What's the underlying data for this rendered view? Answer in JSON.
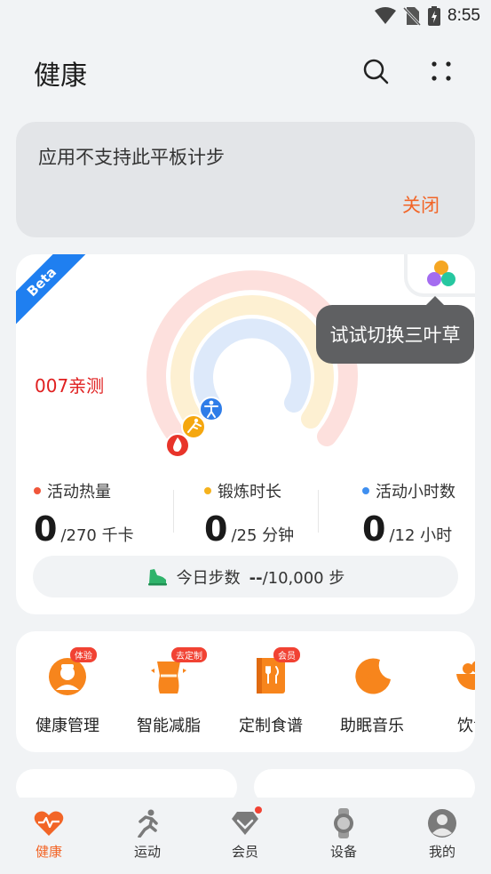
{
  "status_bar": {
    "time": "8:55"
  },
  "header": {
    "title": "健康"
  },
  "notice": {
    "text": "应用不支持此平板计步",
    "close_label": "关闭"
  },
  "activity_card": {
    "badge": "Beta",
    "rings_label": "007亲测",
    "tooltip": "试试切换三叶草",
    "metrics": [
      {
        "label": "活动热量",
        "value": "0",
        "goal": "/270 千卡",
        "color": "#f0563a"
      },
      {
        "label": "锻炼时长",
        "value": "0",
        "goal": "/25 分钟",
        "color": "#f5b21d"
      },
      {
        "label": "活动小时数",
        "value": "0",
        "goal": "/12 小时",
        "color": "#3f8ff0"
      }
    ],
    "steps": {
      "label": "今日步数",
      "value": "--",
      "goal": "/10,000 步"
    }
  },
  "services": [
    {
      "label": "健康管理",
      "badge": "体验"
    },
    {
      "label": "智能减脂",
      "badge": "去定制"
    },
    {
      "label": "定制食谱",
      "badge": "会员"
    },
    {
      "label": "助眠音乐",
      "badge": ""
    },
    {
      "label": "饮食",
      "badge": ""
    }
  ],
  "tabs": [
    {
      "label": "健康",
      "icon": "heart-pulse-icon",
      "active": true
    },
    {
      "label": "运动",
      "icon": "runner-icon",
      "active": false
    },
    {
      "label": "会员",
      "icon": "diamond-icon",
      "active": false
    },
    {
      "label": "设备",
      "icon": "watch-icon",
      "active": false
    },
    {
      "label": "我的",
      "icon": "profile-icon",
      "active": false
    }
  ],
  "colors": {
    "accent": "#f26527",
    "calorie": "#f0563a",
    "exercise": "#f5b21d",
    "hours": "#3f8ff0"
  }
}
